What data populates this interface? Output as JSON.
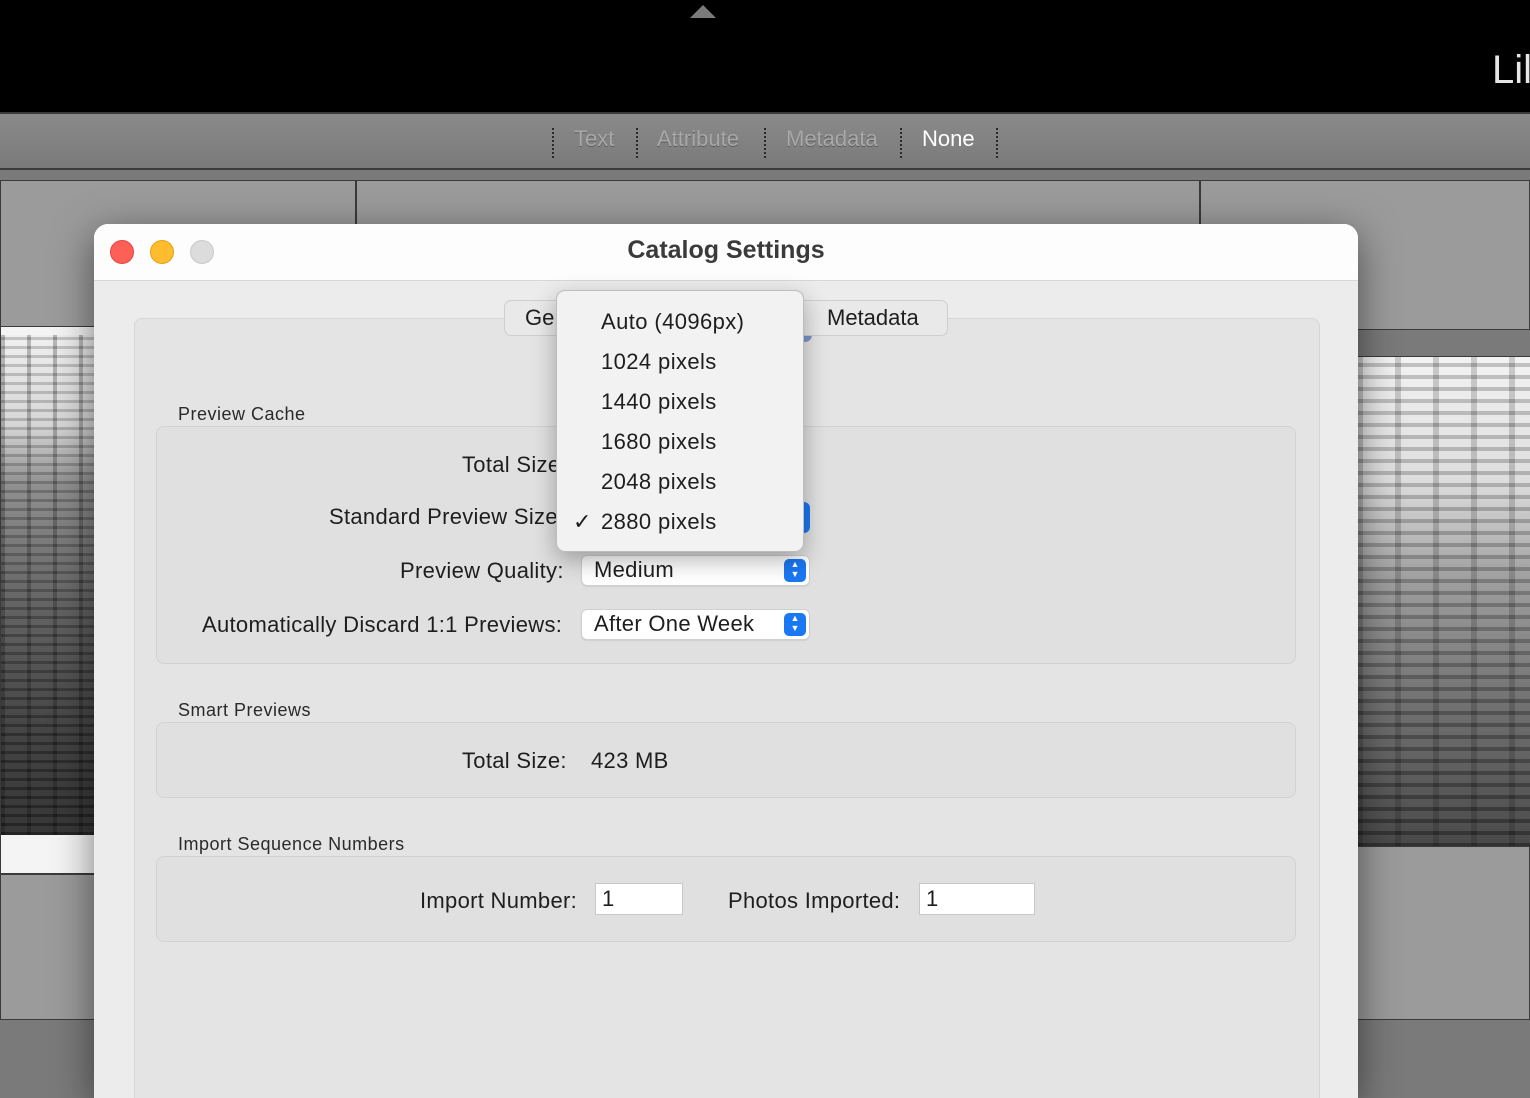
{
  "app": {
    "title": "Lil"
  },
  "filter_bar": {
    "items": [
      "Text",
      "Attribute",
      "Metadata",
      "None"
    ],
    "active": "None"
  },
  "dialog": {
    "title": "Catalog Settings",
    "tabs": {
      "general": "Ge",
      "metadata": "Metadata"
    },
    "preview_cache": {
      "section_label": "Preview Cache",
      "total_size_label": "Total Size",
      "standard_preview_size_label": "Standard Preview Size",
      "preview_quality_label": "Preview Quality:",
      "preview_quality_value": "Medium",
      "discard_label": "Automatically Discard 1:1 Previews:",
      "discard_value": "After One Week"
    },
    "smart_previews": {
      "section_label": "Smart Previews",
      "total_size_label": "Total Size:",
      "total_size_value": "423 MB"
    },
    "import_sequence": {
      "section_label": "Import Sequence Numbers",
      "import_number_label": "Import Number:",
      "import_number_value": "1",
      "photos_imported_label": "Photos Imported:",
      "photos_imported_value": "1"
    }
  },
  "dropdown": {
    "options": [
      "Auto (4096px)",
      "1024 pixels",
      "1440 pixels",
      "1680 pixels",
      "2048 pixels",
      "2880 pixels"
    ],
    "selected": "2880 pixels",
    "check_glyph": "✓"
  },
  "colors": {
    "accent": "#1a78f2",
    "close": "#fe5f57",
    "minimize": "#febc2e",
    "zoom": "#dcdcdc"
  }
}
